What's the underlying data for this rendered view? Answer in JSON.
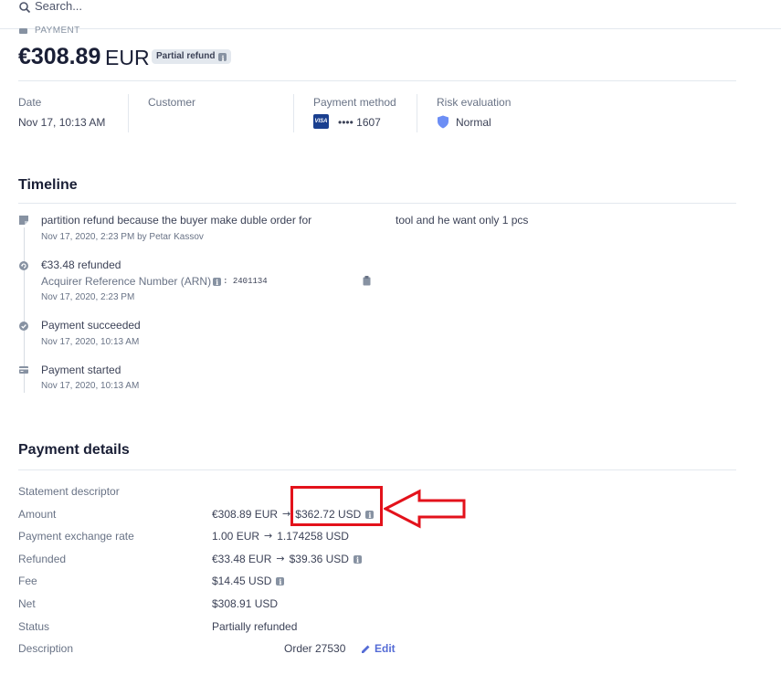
{
  "search": {
    "placeholder": "Search..."
  },
  "header": {
    "label": "PAYMENT",
    "amount": "€308.89",
    "currency": "EUR",
    "status_badge": "Partial refund"
  },
  "summary": {
    "date": {
      "label": "Date",
      "value": "Nov 17, 10:13 AM"
    },
    "customer": {
      "label": "Customer",
      "value": ""
    },
    "payment_method": {
      "label": "Payment method",
      "brand": "VISA",
      "value": "•••• 1607"
    },
    "risk": {
      "label": "Risk evaluation",
      "value": "Normal"
    }
  },
  "timeline": {
    "title": "Timeline",
    "events": [
      {
        "text_a": "partition refund because the buyer make duble order for",
        "text_b": "tool and he want only 1 pcs",
        "meta": "Nov 17, 2020, 2:23 PM by Petar Kassov",
        "icon": "note-icon"
      },
      {
        "text": "€33.48 refunded",
        "arn_label": "Acquirer Reference Number (ARN)",
        "arn_value": ": 2401134",
        "meta": "Nov 17, 2020, 2:23 PM",
        "icon": "refund-icon"
      },
      {
        "text": "Payment succeeded",
        "meta": "Nov 17, 2020, 10:13 AM",
        "icon": "check-circle-icon"
      },
      {
        "text": "Payment started",
        "meta": "Nov 17, 2020, 10:13 AM",
        "icon": "card-icon"
      }
    ]
  },
  "details": {
    "title": "Payment details",
    "rows": {
      "statement_descriptor": {
        "label": "Statement descriptor",
        "value": ""
      },
      "amount": {
        "label": "Amount",
        "from": "€308.89 EUR",
        "to": "$362.72 USD"
      },
      "exchange_rate": {
        "label": "Payment exchange rate",
        "from": "1.00 EUR",
        "to": "1.174258 USD"
      },
      "refunded": {
        "label": "Refunded",
        "from": "€33.48 EUR",
        "to": "$39.36 USD"
      },
      "fee": {
        "label": "Fee",
        "value": "$14.45 USD"
      },
      "net": {
        "label": "Net",
        "value": "$308.91 USD"
      },
      "status": {
        "label": "Status",
        "value": "Partially refunded"
      },
      "description": {
        "label": "Description",
        "value": "Order 27530",
        "edit_label": "Edit"
      }
    }
  },
  "colors": {
    "annotation_red": "#e3121b",
    "link": "#556cd6",
    "text_dark": "#1a1f36"
  }
}
